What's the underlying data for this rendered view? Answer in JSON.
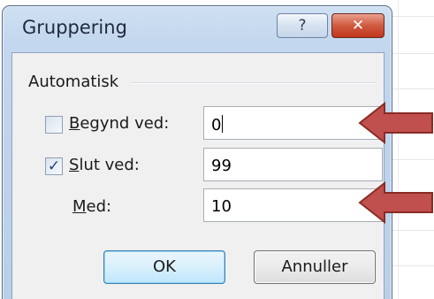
{
  "window": {
    "title": "Gruppering",
    "help_glyph": "?",
    "close_glyph": "✕"
  },
  "group": {
    "label": "Automatisk"
  },
  "fields": {
    "start": {
      "label_acc": "B",
      "label_rest": "egynd ved:",
      "value": "0",
      "checked": false
    },
    "end": {
      "label_acc": "S",
      "label_rest": "lut ved:",
      "value": "99",
      "checked": true,
      "check_glyph": "✓"
    },
    "by": {
      "label_acc": "M",
      "label_rest": "ed:",
      "value": "10"
    }
  },
  "buttons": {
    "ok": "OK",
    "cancel": "Annuller"
  },
  "colors": {
    "arrow_fill": "#c0504d",
    "arrow_stroke": "#8b2a24"
  }
}
